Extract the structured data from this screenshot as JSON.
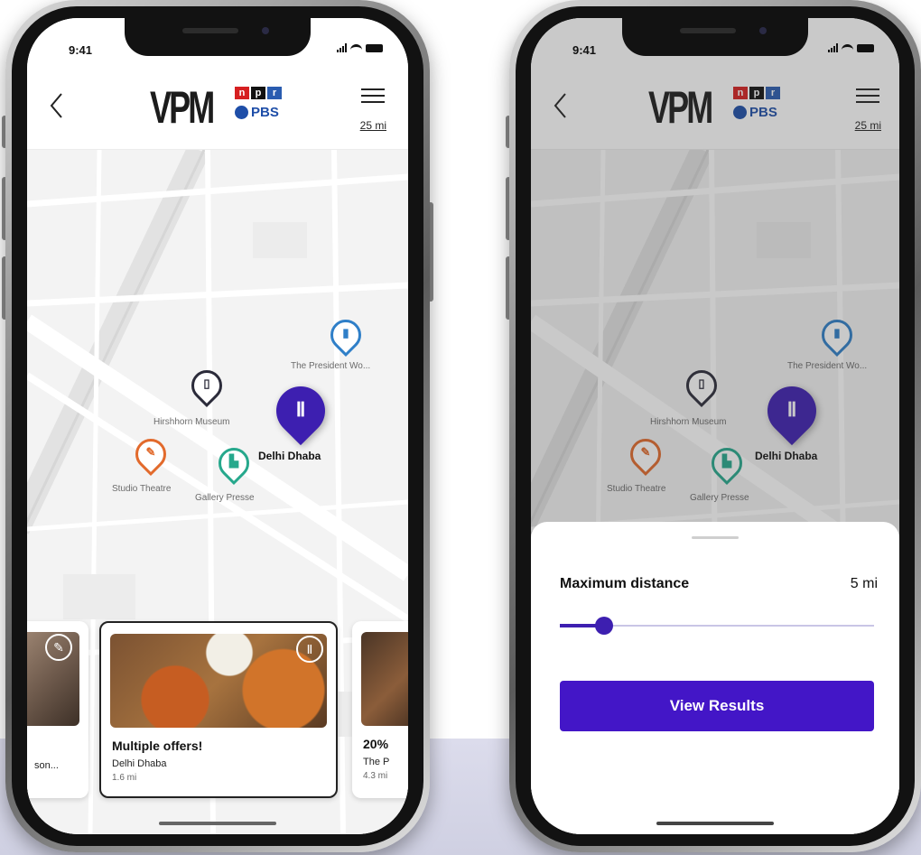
{
  "status_bar": {
    "time": "9:41"
  },
  "header": {
    "logo_text": "VPM",
    "npr_letters": [
      "n",
      "p",
      "r"
    ],
    "pbs_text": "PBS",
    "distance": "25 mi",
    "icons": [
      "back-chevron-icon",
      "list-menu-icon"
    ]
  },
  "map": {
    "pins": [
      {
        "label": "The President Wo...",
        "icon": "luggage-icon",
        "color": "#2f7fc8"
      },
      {
        "label": "Hirshhorn Museum",
        "icon": "phone-icon",
        "color": "#2b2b3a"
      },
      {
        "label": "Delhi Dhaba",
        "icon": "fork-knife-icon",
        "color": "#3d1fb0",
        "selected": true
      },
      {
        "label": "Studio Theatre",
        "icon": "ticket-icon",
        "color": "#e26a2c"
      },
      {
        "label": "Gallery Presse",
        "icon": "shopping-bag-icon",
        "color": "#26a88c"
      }
    ]
  },
  "cards": [
    {
      "title": "",
      "sub": "son...",
      "meta": "",
      "icon": "ticket-icon"
    },
    {
      "title": "Multiple offers!",
      "sub": "Delhi Dhaba",
      "meta": "1.6 mi",
      "icon": "fork-knife-icon"
    },
    {
      "title": "20%",
      "sub": "The P",
      "meta": "4.3 mi",
      "icon": ""
    }
  ],
  "filter_sheet": {
    "label": "Maximum distance",
    "value": "5 mi",
    "slider_fraction": 0.14,
    "button": "View Results"
  },
  "colors": {
    "accent": "#4316c7",
    "npr_red": "#d62021",
    "npr_blue": "#2a5cb0",
    "pbs_blue": "#1e4ea8"
  }
}
